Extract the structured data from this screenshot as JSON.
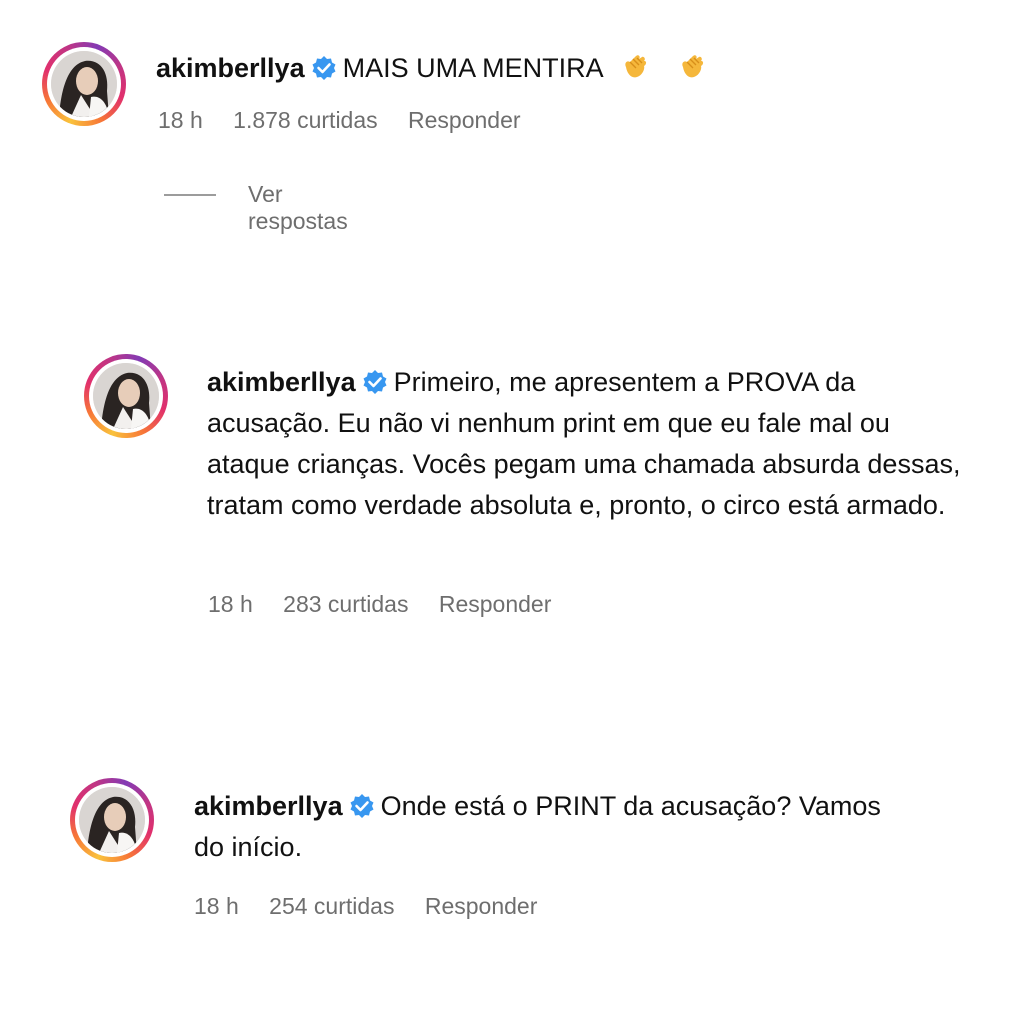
{
  "comments": [
    {
      "username": "akimberllya",
      "text": "MAIS UMA MENTIRA",
      "emojis": [
        "clapping-hands",
        "clapping-hands"
      ],
      "time": "18 h",
      "likes": "1.878 curtidas",
      "reply_label": "Responder",
      "view_replies": "Ver respostas"
    },
    {
      "username": "akimberllya",
      "text": "Primeiro, me apresentem a PROVA da acusação. Eu não vi nenhum print em que eu fale mal ou ataque crianças. Vocês pegam uma chamada absurda dessas, tratam como verdade absoluta e, pronto, o circo está armado.",
      "time": "18 h",
      "likes": "283 curtidas",
      "reply_label": "Responder"
    },
    {
      "username": "akimberllya",
      "text": "Onde está o PRINT da acusação? Vamos do início.",
      "time": "18 h",
      "likes": "254 curtidas",
      "reply_label": "Responder"
    }
  ],
  "colors": {
    "verified_badge": "#3897f0",
    "meta_text": "#6e6e6e"
  }
}
